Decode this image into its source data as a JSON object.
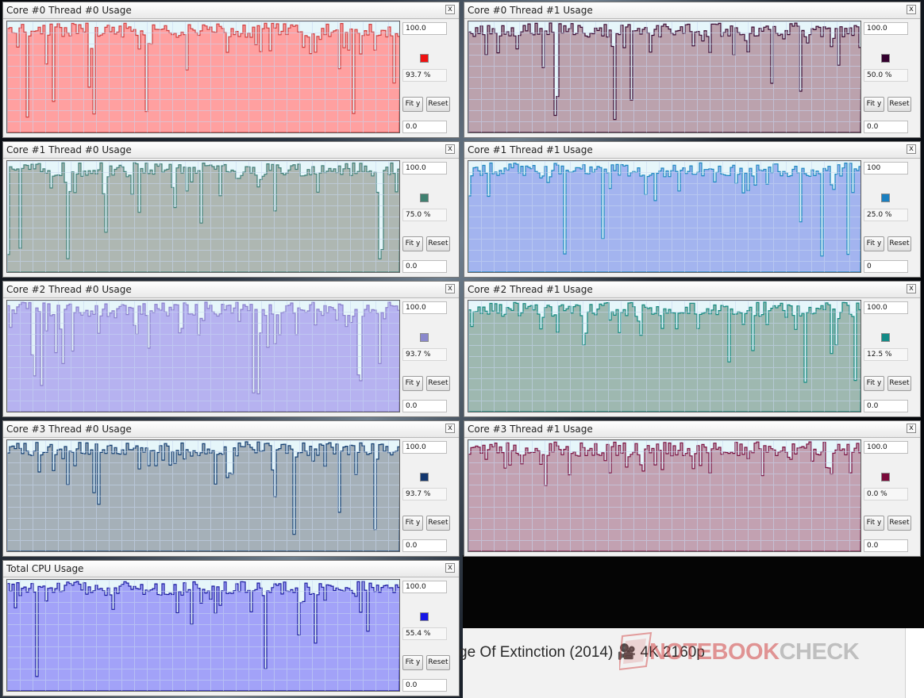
{
  "panels": [
    {
      "title": "Core #0 Thread #0 Usage",
      "max_label": "100.0",
      "current": "93.7 %",
      "min_label": "0.0",
      "line_color": "#d04040",
      "fill_color": "#ffa0a0",
      "swatch_color": "#ee1111",
      "close": "x",
      "fit_label": "Fit y",
      "reset_label": "Reset",
      "seed": 11
    },
    {
      "title": "Core #0 Thread #1 Usage",
      "max_label": "100.0",
      "current": "50.0 %",
      "min_label": "0.0",
      "line_color": "#3a0a33",
      "fill_color": "#bba2ad",
      "swatch_color": "#33002e",
      "close": "x",
      "fit_label": "Fit y",
      "reset_label": "Reset",
      "seed": 23
    },
    {
      "title": "Core #1 Thread #0 Usage",
      "max_label": "100.0",
      "current": "75.0 %",
      "min_label": "0.0",
      "line_color": "#3f8078",
      "fill_color": "#aeb7b2",
      "swatch_color": "#3f8070",
      "close": "x",
      "fit_label": "Fit y",
      "reset_label": "Reset",
      "seed": 37
    },
    {
      "title": "Core #1 Thread #1 Usage",
      "max_label": "100",
      "current": "25.0 %",
      "min_label": "0",
      "line_color": "#1a88c0",
      "fill_color": "#a3b4ef",
      "swatch_color": "#1a7fc0",
      "close": "x",
      "fit_label": "Fit y",
      "reset_label": "Reset",
      "seed": 41
    },
    {
      "title": "Core #2 Thread #0 Usage",
      "max_label": "100.0",
      "current": "93.7 %",
      "min_label": "0.0",
      "line_color": "#8a80cc",
      "fill_color": "#b6b2f0",
      "swatch_color": "#8a88cc",
      "close": "x",
      "fit_label": "Fit y",
      "reset_label": "Reset",
      "seed": 53
    },
    {
      "title": "Core #2 Thread #1 Usage",
      "max_label": "100.0",
      "current": "12.5 %",
      "min_label": "0.0",
      "line_color": "#138a80",
      "fill_color": "#9eb8b0",
      "swatch_color": "#138a86",
      "close": "x",
      "fit_label": "Fit y",
      "reset_label": "Reset",
      "seed": 67
    },
    {
      "title": "Core #3 Thread #0 Usage",
      "max_label": "100.0",
      "current": "93.7 %",
      "min_label": "0.0",
      "line_color": "#123e72",
      "fill_color": "#a5b0b8",
      "swatch_color": "#12366e",
      "close": "x",
      "fit_label": "Fit y",
      "reset_label": "Reset",
      "seed": 79
    },
    {
      "title": "Core #3 Thread #1 Usage",
      "max_label": "100.0",
      "current": "0.0 %",
      "min_label": "0.0",
      "line_color": "#7a1040",
      "fill_color": "#c2a1b1",
      "swatch_color": "#7a0a3a",
      "close": "x",
      "fit_label": "Fit y",
      "reset_label": "Reset",
      "seed": 83
    },
    {
      "title": "Total CPU Usage",
      "max_label": "100.0",
      "current": "55.4 %",
      "min_label": "0.0",
      "line_color": "#1a1aa0",
      "fill_color": "#a2a2f8",
      "swatch_color": "#1616e6",
      "close": "x",
      "fit_label": "Fit y",
      "reset_label": "Reset",
      "seed": 97
    }
  ],
  "background": {
    "media_title": "ge Of Extinction (2014) 🎥 4K 2160p",
    "watermark_a": "NOTEBOOK",
    "watermark_b": "CHECK"
  },
  "colors": {
    "grid": "#c8d8f2",
    "empty_area": "#e6f6fa",
    "window_bg": "#f1f1f1"
  }
}
